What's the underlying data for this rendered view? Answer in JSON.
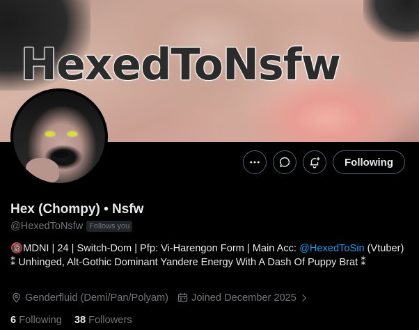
{
  "banner": {
    "title": "HexedToNsfw"
  },
  "profile": {
    "display_name": "Hex (Chompy) • Nsfw",
    "handle": "@HexedToNsfw",
    "follows_you": "Follows you",
    "bio_part1": "🔞MDNI | 24 | Switch-Dom | Pfp: Vi-Harengon Form | Main Acc: ",
    "bio_link": "@HexedToSin",
    "bio_part2": " (Vtuber) ⁑ Unhinged, Alt-Gothic Dominant Yandere Energy With A Dash Of Puppy Brat ⁑",
    "location": "Genderfluid (Demi/Pan/Polyam)",
    "joined": "Joined December 2025"
  },
  "actions": {
    "more_icon": "more-icon",
    "message_icon": "message-icon",
    "notify_icon": "notification-bell-icon",
    "follow_label": "Following"
  },
  "stats": {
    "following_count": "6",
    "following_label": "Following",
    "followers_count": "38",
    "followers_label": "Followers"
  },
  "colors": {
    "background": "#000000",
    "text": "#e7e9ea",
    "muted": "#71767b",
    "link": "#1d9bf0",
    "border": "#536471"
  }
}
